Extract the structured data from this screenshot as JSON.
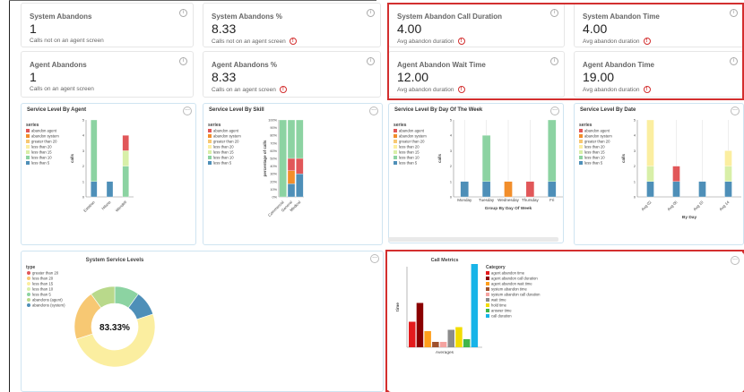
{
  "kpis": [
    {
      "title": "System Abandons",
      "value": "1",
      "sub": "Calls not on an agent screen",
      "warn": false
    },
    {
      "title": "System Abandons %",
      "value": "8.33",
      "sub": "Calls not on an agent screen",
      "warn": true
    },
    {
      "title": "System Abandon Call Duration",
      "value": "4.00",
      "sub": "Avg abandon duration",
      "warn": true
    },
    {
      "title": "System Abandon Time",
      "value": "4.00",
      "sub": "Avg abandon duration",
      "warn": true
    },
    {
      "title": "Agent Abandons",
      "value": "1",
      "sub": "Calls on an agent screen",
      "warn": false
    },
    {
      "title": "Agent Abandons %",
      "value": "8.33",
      "sub": "Calls on an agent screen",
      "warn": true
    },
    {
      "title": "Agent Abandon Wait Time",
      "value": "12.00",
      "sub": "Avg abandon duration",
      "warn": true
    },
    {
      "title": "Agent Abandon Time",
      "value": "19.00",
      "sub": "Avg abandon duration",
      "warn": true
    }
  ],
  "icons": {
    "info": "i",
    "warn": "!",
    "more": "...",
    "info_name": "info-icon",
    "warn_name": "warning-icon",
    "more_name": "more-options-icon"
  },
  "colors": {
    "abandon_agent": "#e15759",
    "abandon_system": "#f28e2b",
    "greater_than_20": "#f7c873",
    "less_than_20": "#fbeea0",
    "less_than_15": "#d8efa8",
    "less_than_10": "#8cd3a2",
    "less_than_5": "#4e8fb8"
  },
  "series_legend": {
    "heading": "series",
    "items": [
      "abandon agent",
      "abandon system",
      "greater than 20",
      "less than 20",
      "less than 15",
      "less than 10",
      "less than 5"
    ]
  },
  "panels": {
    "by_agent": {
      "title": "Service Level By Agent",
      "ylabel": "calls",
      "ticks": [
        "0",
        "1",
        "2",
        "3",
        "4",
        "5"
      ]
    },
    "by_skill": {
      "title": "Service Level By Skill",
      "ylabel": "percentage of calls",
      "ticks": [
        "0%",
        "10%",
        "20%",
        "30%",
        "40%",
        "50%",
        "60%",
        "70%",
        "80%",
        "90%",
        "100%"
      ]
    },
    "by_day": {
      "title": "Service Level By Day Of The Week",
      "ylabel": "calls",
      "xlabel": "Group By Day Of Week",
      "ticks": [
        "0",
        "1",
        "2",
        "3",
        "4",
        "5"
      ]
    },
    "by_date": {
      "title": "Service Level By Date",
      "ylabel": "calls",
      "xlabel": "By Day",
      "ticks": [
        "0",
        "1",
        "2",
        "3",
        "4",
        "5"
      ]
    },
    "system_levels": {
      "title": "System Service Levels",
      "center": "83.33%"
    },
    "call_metrics": {
      "title": "Call Metrics",
      "ylabel": "time",
      "xlabel": "Averages"
    }
  },
  "chart_data": [
    {
      "type": "bar",
      "title": "Service Level By Agent",
      "ylabel": "calls",
      "ylim": [
        0,
        5
      ],
      "categories": [
        "Esteban",
        "Hilario",
        "Wendell"
      ],
      "series": [
        {
          "name": "less than 5",
          "values": [
            1,
            1,
            0
          ]
        },
        {
          "name": "less than 10",
          "values": [
            4,
            0,
            2
          ]
        },
        {
          "name": "less than 15",
          "values": [
            0,
            0,
            1
          ]
        },
        {
          "name": "abandon agent",
          "values": [
            0,
            0,
            1
          ]
        },
        {
          "name": "less than 20",
          "values": [
            0,
            0,
            0
          ]
        }
      ]
    },
    {
      "type": "bar",
      "title": "Service Level By Skill",
      "ylabel": "percentage of calls",
      "ylim": [
        0,
        100
      ],
      "categories": [
        "Commercial",
        "General",
        "Medical"
      ],
      "series": [
        {
          "name": "less than 5",
          "values": [
            0,
            17,
            30
          ]
        },
        {
          "name": "abandon system",
          "values": [
            0,
            17,
            0
          ]
        },
        {
          "name": "greater than 20",
          "values": [
            0,
            0,
            0
          ]
        },
        {
          "name": "abandon agent",
          "values": [
            0,
            16,
            20
          ]
        },
        {
          "name": "less than 10",
          "values": [
            100,
            50,
            50
          ]
        }
      ]
    },
    {
      "type": "bar",
      "title": "Service Level By Day Of The Week",
      "xlabel": "Group By Day Of Week",
      "ylabel": "calls",
      "ylim": [
        0,
        5
      ],
      "categories": [
        "Monday",
        "Tuesday",
        "Wednesday",
        "Thursday",
        "Fri"
      ],
      "series": [
        {
          "name": "less than 5",
          "values": [
            1,
            1,
            0,
            0,
            1
          ]
        },
        {
          "name": "abandon system",
          "values": [
            0,
            0,
            1,
            0,
            0
          ]
        },
        {
          "name": "abandon agent",
          "values": [
            0,
            0,
            0,
            1,
            0
          ]
        },
        {
          "name": "less than 10",
          "values": [
            0,
            3,
            0,
            0,
            4
          ]
        }
      ]
    },
    {
      "type": "bar",
      "title": "Service Level By Date",
      "xlabel": "By Day",
      "ylabel": "calls",
      "ylim": [
        0,
        5
      ],
      "categories": [
        "Aug 02",
        "Aug 06",
        "Aug 10",
        "Aug 14"
      ],
      "series": [
        {
          "name": "less than 5",
          "values": [
            1,
            1,
            1,
            1
          ]
        },
        {
          "name": "abandon agent",
          "values": [
            0,
            1,
            0,
            0
          ]
        },
        {
          "name": "less than 15",
          "values": [
            1,
            0,
            0,
            1
          ]
        },
        {
          "name": "less than 20",
          "values": [
            3,
            0,
            0,
            1
          ]
        }
      ]
    },
    {
      "type": "pie",
      "title": "System Service Levels",
      "legend_heading": "type",
      "center_label": "83.33%",
      "labels": [
        "greater than 20",
        "less than 20",
        "less than 15",
        "less than 10",
        "less than 5",
        "abandons (agent)",
        "abandons (system)"
      ],
      "values": [
        0,
        16.7,
        41.7,
        0,
        8.3,
        8.3,
        8.3
      ],
      "colors": [
        "#e15759",
        "#f7c873",
        "#fbeea0",
        "#d8efa8",
        "#8cd3a2",
        "#b9d98b",
        "#4e8fb8"
      ]
    },
    {
      "type": "bar",
      "title": "Call Metrics",
      "xlabel": "Averages",
      "ylabel": "time",
      "ylim": [
        0,
        60
      ],
      "legend_heading": "Category",
      "categories": [
        "agent abandon time",
        "agent abandon call duration",
        "agent abandon wait time",
        "system abandon time",
        "system abandon call duration",
        "wait time",
        "hold time",
        "answer time",
        "call duration"
      ],
      "values": [
        19,
        33,
        12,
        4,
        4,
        13,
        15,
        6,
        62
      ],
      "colors": [
        "#e41a1c",
        "#8b0000",
        "#ff9e1b",
        "#a0522d",
        "#f5a3a0",
        "#8c8c8c",
        "#f2dc00",
        "#41b64a",
        "#17b4e8"
      ]
    }
  ]
}
